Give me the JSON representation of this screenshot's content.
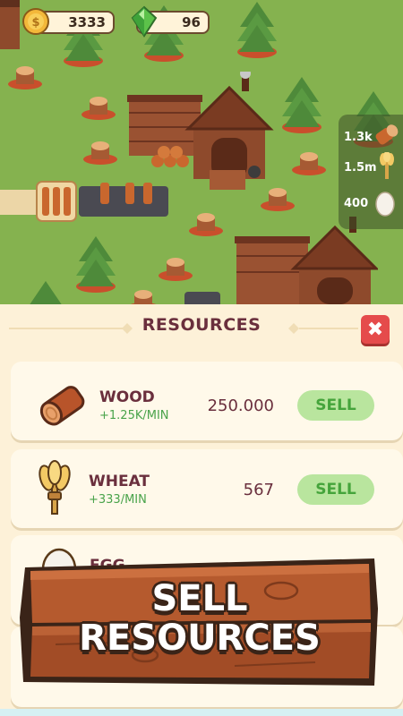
{
  "hud": {
    "coins": "3333",
    "gems": "96"
  },
  "side_panel": {
    "wood": "1.3k",
    "wheat": "1.5m",
    "eggs": "400"
  },
  "panel": {
    "title": "RESOURCES",
    "close_icon": "close-x-icon"
  },
  "resources": [
    {
      "name": "WOOD",
      "rate": "+1.25K/MIN",
      "amount": "250.000",
      "sell_label": "SELL",
      "icon": "log-icon"
    },
    {
      "name": "WHEAT",
      "rate": "+333/MIN",
      "amount": "567",
      "sell_label": "SELL",
      "icon": "wheat-icon"
    },
    {
      "name": "EGG",
      "icon": "egg-icon"
    }
  ],
  "banner": {
    "line1": "SELL",
    "line2": "RESOURCES"
  },
  "colors": {
    "grass": "#85b24f",
    "panel_bg": "#fdf1d8",
    "title": "#6a2f3d",
    "sell_bg": "#b9e59e",
    "sell_text": "#45a43b",
    "rate_text": "#49a34a",
    "close_bg": "#e54b4b",
    "wood_banner": "#a8562e"
  }
}
